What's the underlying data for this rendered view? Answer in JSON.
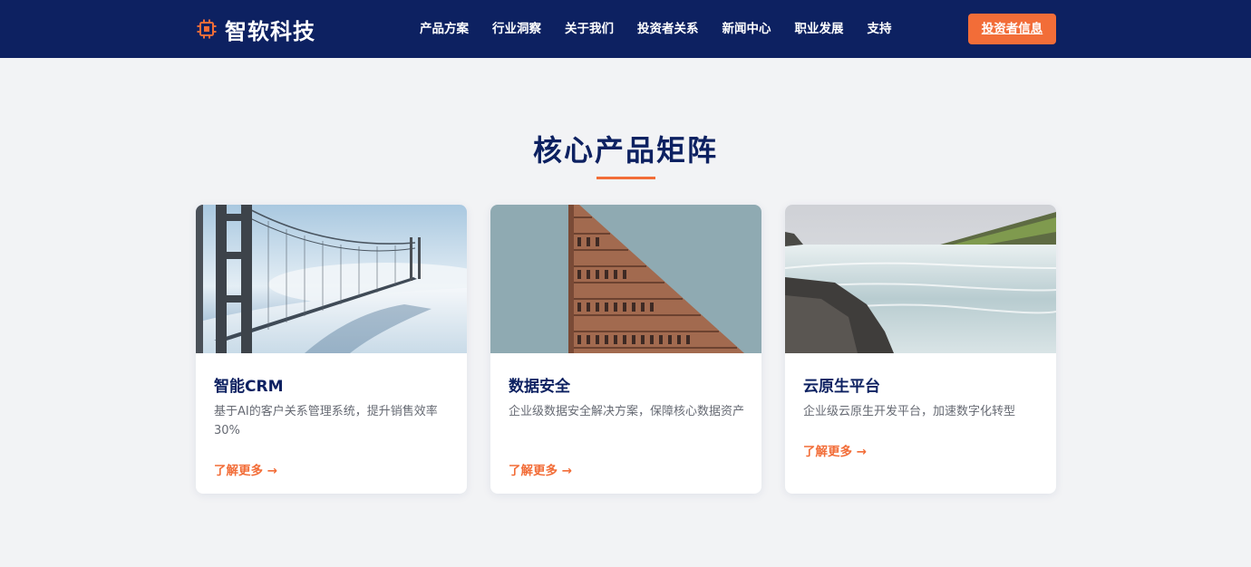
{
  "brand": {
    "name": "智软科技",
    "accent": "#f26d38",
    "navy": "#0d2161"
  },
  "nav": {
    "items": [
      "产品方案",
      "行业洞察",
      "关于我们",
      "投资者关系",
      "新闻中心",
      "职业发展",
      "支持"
    ]
  },
  "cta": {
    "label": "投资者信息"
  },
  "section": {
    "title": "核心产品矩阵"
  },
  "cards": [
    {
      "title": "智能CRM",
      "desc": "基于AI的客户关系管理系统，提升销售效率30%",
      "link": "了解更多 →",
      "image": "golden-gate-bridge-in-fog"
    },
    {
      "title": "数据安全",
      "desc": "企业级数据安全解决方案，保障核心数据资产",
      "link": "了解更多 →",
      "image": "flatiron-building"
    },
    {
      "title": "云原生平台",
      "desc": "企业级云原生开发平台，加速数字化转型",
      "link": "了解更多 →",
      "image": "waterfall-landscape"
    }
  ]
}
